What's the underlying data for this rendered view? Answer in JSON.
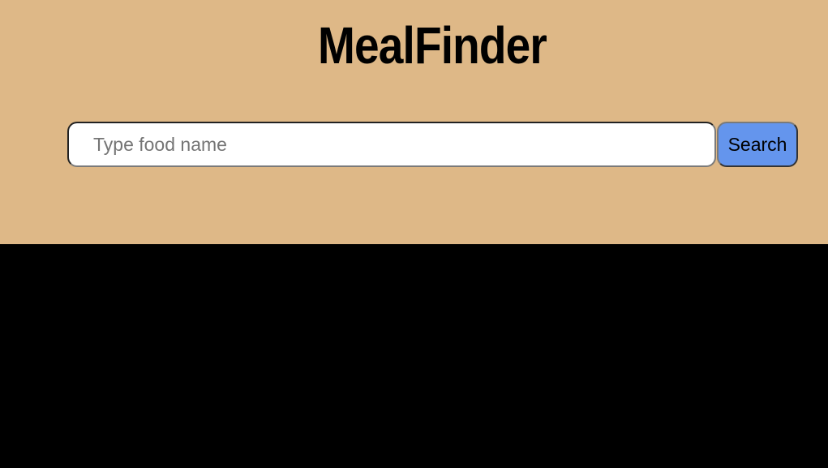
{
  "header": {
    "title": "MealFinder"
  },
  "search": {
    "placeholder": "Type food name",
    "value": "",
    "button_label": "Search"
  },
  "colors": {
    "header_background": "#deb887",
    "page_background": "#000000",
    "button_background": "#6495ed"
  }
}
